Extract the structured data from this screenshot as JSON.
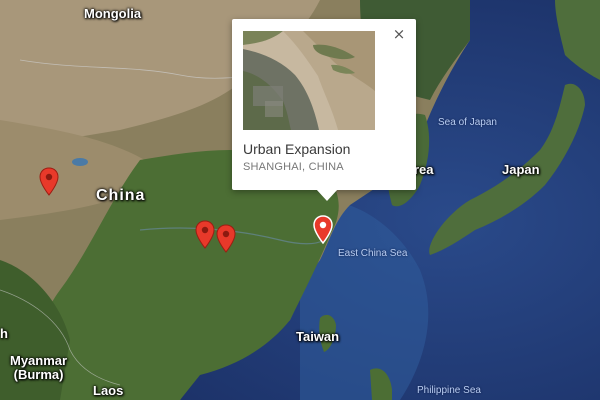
{
  "labels": {
    "mongolia": "Mongolia",
    "china": "China",
    "korea_partial": "rea",
    "japan": "Japan",
    "sea_of_japan": "Sea of Japan",
    "east_china_sea": "East China Sea",
    "taiwan": "Taiwan",
    "myanmar": "Myanmar\n(Burma)",
    "laos": "Laos",
    "philippine_sea": "Philippine Sea",
    "edge_letter": "h"
  },
  "info_window": {
    "title": "Urban Expansion",
    "subtitle": "SHANGHAI, CHINA",
    "close_symbol": "×",
    "thumbnail": "shanghai-satellite-thumbnail"
  },
  "markers": [
    {
      "name": "tibet-marker",
      "label": ""
    },
    {
      "name": "central-china-marker-1",
      "label": ""
    },
    {
      "name": "central-china-marker-2",
      "label": ""
    },
    {
      "name": "shanghai-marker",
      "label": ""
    }
  ],
  "colors": {
    "marker": "#e8392a",
    "ocean": "#243f78",
    "land": "#4a6b3a"
  }
}
